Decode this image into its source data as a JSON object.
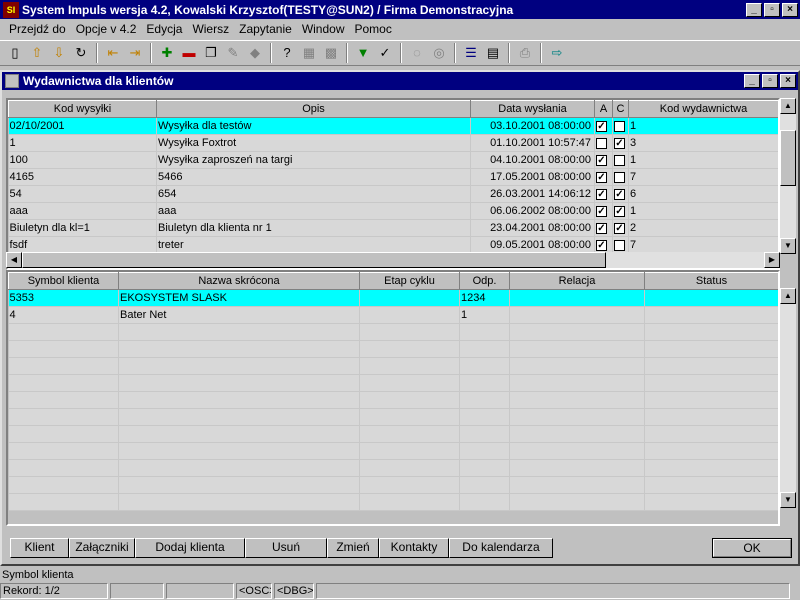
{
  "app": {
    "title": "System Impuls wersja 4.2, Kowalski Krzysztof(TESTY@SUN2) / Firma Demonstracyjna",
    "icon_text": "SI"
  },
  "window_controls": {
    "minimize": "_",
    "restore": "▫",
    "close": "×"
  },
  "menu": [
    "Przejdź do",
    "Opcje v 4.2",
    "Edycja",
    "Wiersz",
    "Zapytanie",
    "Window",
    "Pomoc"
  ],
  "toolbar_icons": [
    {
      "name": "new-doc-icon",
      "glyph": "▯"
    },
    {
      "name": "arrow-up-icon",
      "glyph": "⇧"
    },
    {
      "name": "arrow-down-icon",
      "glyph": "⇩"
    },
    {
      "name": "refresh-icon",
      "glyph": "↻"
    },
    {
      "name": "first-record-icon",
      "glyph": "⇤"
    },
    {
      "name": "last-record-icon",
      "glyph": "⇥"
    },
    {
      "name": "add-record-icon",
      "glyph": "✚"
    },
    {
      "name": "delete-record-icon",
      "glyph": "▬"
    },
    {
      "name": "copy-record-icon",
      "glyph": "❐"
    },
    {
      "name": "edit-record-icon",
      "glyph": "✎"
    },
    {
      "name": "eraser-icon",
      "glyph": "◆"
    },
    {
      "name": "query-help-icon",
      "glyph": "?"
    },
    {
      "name": "query-icon",
      "glyph": "▦"
    },
    {
      "name": "query-run-icon",
      "glyph": "▩"
    },
    {
      "name": "filter-icon",
      "glyph": "▼"
    },
    {
      "name": "clear-filter-icon",
      "glyph": "✓"
    },
    {
      "name": "calendar-icon",
      "glyph": "◌"
    },
    {
      "name": "schedule-icon",
      "glyph": "◎"
    },
    {
      "name": "report-icon",
      "glyph": "☰"
    },
    {
      "name": "print-preview-icon",
      "glyph": "▤"
    },
    {
      "name": "print-icon",
      "glyph": "⎙"
    },
    {
      "name": "exit-icon",
      "glyph": "⇨"
    }
  ],
  "child_window": {
    "title": "Wydawnictwa dla klientów"
  },
  "top_grid": {
    "columns": [
      "Kod wysyłki",
      "Opis",
      "Data wysłania",
      "A",
      "C",
      "Kod wydawnictwa"
    ],
    "rows": [
      {
        "kod": "02/10/2001",
        "opis": "Wysyłka dla testów",
        "data": "03.10.2001 08:00:00",
        "a": "✓",
        "c": "",
        "kw": "1",
        "selected": true
      },
      {
        "kod": "1",
        "opis": "Wysyłka Foxtrot",
        "data": "01.10.2001 10:57:47",
        "a": "",
        "c": "✓",
        "kw": "3",
        "selected": false
      },
      {
        "kod": "100",
        "opis": "Wysyłka zaproszeń na targi",
        "data": "04.10.2001 08:00:00",
        "a": "✓",
        "c": "",
        "kw": "1",
        "selected": false
      },
      {
        "kod": "4165",
        "opis": "5466",
        "data": "17.05.2001 08:00:00",
        "a": "✓",
        "c": "",
        "kw": "7",
        "selected": false
      },
      {
        "kod": "54",
        "opis": "654",
        "data": "26.03.2001 14:06:12",
        "a": "✓",
        "c": "✓",
        "kw": "6",
        "selected": false
      },
      {
        "kod": "aaa",
        "opis": "aaa",
        "data": "06.06.2002 08:00:00",
        "a": "✓",
        "c": "✓",
        "kw": "1",
        "selected": false
      },
      {
        "kod": "Biuletyn dla kl=1",
        "opis": "Biuletyn dla klienta nr 1",
        "data": "23.04.2001 08:00:00",
        "a": "✓",
        "c": "✓",
        "kw": "2",
        "selected": false
      },
      {
        "kod": "fsdf",
        "opis": "treter",
        "data": "09.05.2001 08:00:00",
        "a": "✓",
        "c": "",
        "kw": "7",
        "selected": false
      }
    ]
  },
  "bottom_grid": {
    "columns": [
      "Symbol klienta",
      "Nazwa skrócona",
      "Etap cyklu",
      "Odp.",
      "Relacja",
      "Status"
    ],
    "rows": [
      {
        "symbol": "5353",
        "nazwa": "EKOSYSTEM SLASK",
        "etap": "",
        "odp": "1234",
        "relacja": "",
        "status": "",
        "selected": true
      },
      {
        "symbol": "4",
        "nazwa": "Bater Net",
        "etap": "",
        "odp": "1",
        "relacja": "",
        "status": "",
        "selected": false
      }
    ]
  },
  "buttons": {
    "klient": "Klient",
    "zalaczniki": "Załączniki",
    "dodaj_klienta": "Dodaj klienta",
    "usun": "Usuń",
    "zmien": "Zmień",
    "kontakty": "Kontakty",
    "do_kalendarza": "Do kalendarza",
    "ok": "OK"
  },
  "status": {
    "hint": "Symbol klienta",
    "rekord": "Rekord: 1/2",
    "osc": "<OSC>",
    "dbg": "<DBG>"
  }
}
